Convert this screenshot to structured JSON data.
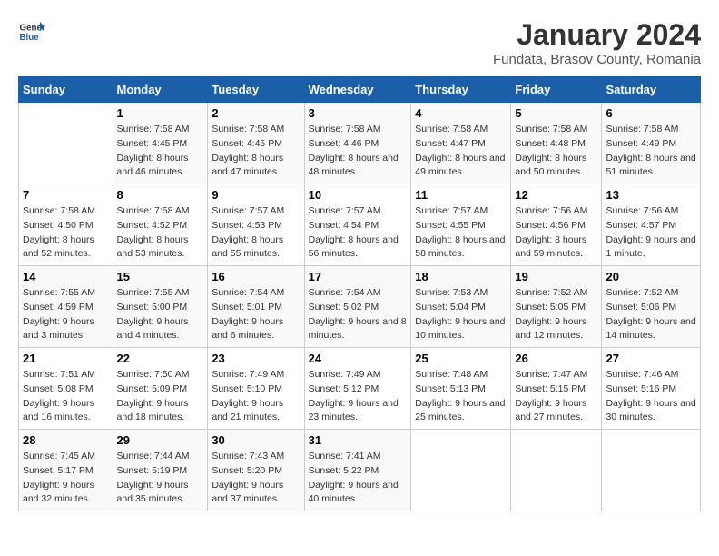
{
  "header": {
    "logo_general": "General",
    "logo_blue": "Blue",
    "title": "January 2024",
    "subtitle": "Fundata, Brasov County, Romania"
  },
  "calendar": {
    "days_of_week": [
      "Sunday",
      "Monday",
      "Tuesday",
      "Wednesday",
      "Thursday",
      "Friday",
      "Saturday"
    ],
    "weeks": [
      [
        {
          "day": "",
          "sunrise": "",
          "sunset": "",
          "daylight": ""
        },
        {
          "day": "1",
          "sunrise": "Sunrise: 7:58 AM",
          "sunset": "Sunset: 4:45 PM",
          "daylight": "Daylight: 8 hours and 46 minutes."
        },
        {
          "day": "2",
          "sunrise": "Sunrise: 7:58 AM",
          "sunset": "Sunset: 4:45 PM",
          "daylight": "Daylight: 8 hours and 47 minutes."
        },
        {
          "day": "3",
          "sunrise": "Sunrise: 7:58 AM",
          "sunset": "Sunset: 4:46 PM",
          "daylight": "Daylight: 8 hours and 48 minutes."
        },
        {
          "day": "4",
          "sunrise": "Sunrise: 7:58 AM",
          "sunset": "Sunset: 4:47 PM",
          "daylight": "Daylight: 8 hours and 49 minutes."
        },
        {
          "day": "5",
          "sunrise": "Sunrise: 7:58 AM",
          "sunset": "Sunset: 4:48 PM",
          "daylight": "Daylight: 8 hours and 50 minutes."
        },
        {
          "day": "6",
          "sunrise": "Sunrise: 7:58 AM",
          "sunset": "Sunset: 4:49 PM",
          "daylight": "Daylight: 8 hours and 51 minutes."
        }
      ],
      [
        {
          "day": "7",
          "sunrise": "Sunrise: 7:58 AM",
          "sunset": "Sunset: 4:50 PM",
          "daylight": "Daylight: 8 hours and 52 minutes."
        },
        {
          "day": "8",
          "sunrise": "Sunrise: 7:58 AM",
          "sunset": "Sunset: 4:52 PM",
          "daylight": "Daylight: 8 hours and 53 minutes."
        },
        {
          "day": "9",
          "sunrise": "Sunrise: 7:57 AM",
          "sunset": "Sunset: 4:53 PM",
          "daylight": "Daylight: 8 hours and 55 minutes."
        },
        {
          "day": "10",
          "sunrise": "Sunrise: 7:57 AM",
          "sunset": "Sunset: 4:54 PM",
          "daylight": "Daylight: 8 hours and 56 minutes."
        },
        {
          "day": "11",
          "sunrise": "Sunrise: 7:57 AM",
          "sunset": "Sunset: 4:55 PM",
          "daylight": "Daylight: 8 hours and 58 minutes."
        },
        {
          "day": "12",
          "sunrise": "Sunrise: 7:56 AM",
          "sunset": "Sunset: 4:56 PM",
          "daylight": "Daylight: 8 hours and 59 minutes."
        },
        {
          "day": "13",
          "sunrise": "Sunrise: 7:56 AM",
          "sunset": "Sunset: 4:57 PM",
          "daylight": "Daylight: 9 hours and 1 minute."
        }
      ],
      [
        {
          "day": "14",
          "sunrise": "Sunrise: 7:55 AM",
          "sunset": "Sunset: 4:59 PM",
          "daylight": "Daylight: 9 hours and 3 minutes."
        },
        {
          "day": "15",
          "sunrise": "Sunrise: 7:55 AM",
          "sunset": "Sunset: 5:00 PM",
          "daylight": "Daylight: 9 hours and 4 minutes."
        },
        {
          "day": "16",
          "sunrise": "Sunrise: 7:54 AM",
          "sunset": "Sunset: 5:01 PM",
          "daylight": "Daylight: 9 hours and 6 minutes."
        },
        {
          "day": "17",
          "sunrise": "Sunrise: 7:54 AM",
          "sunset": "Sunset: 5:02 PM",
          "daylight": "Daylight: 9 hours and 8 minutes."
        },
        {
          "day": "18",
          "sunrise": "Sunrise: 7:53 AM",
          "sunset": "Sunset: 5:04 PM",
          "daylight": "Daylight: 9 hours and 10 minutes."
        },
        {
          "day": "19",
          "sunrise": "Sunrise: 7:52 AM",
          "sunset": "Sunset: 5:05 PM",
          "daylight": "Daylight: 9 hours and 12 minutes."
        },
        {
          "day": "20",
          "sunrise": "Sunrise: 7:52 AM",
          "sunset": "Sunset: 5:06 PM",
          "daylight": "Daylight: 9 hours and 14 minutes."
        }
      ],
      [
        {
          "day": "21",
          "sunrise": "Sunrise: 7:51 AM",
          "sunset": "Sunset: 5:08 PM",
          "daylight": "Daylight: 9 hours and 16 minutes."
        },
        {
          "day": "22",
          "sunrise": "Sunrise: 7:50 AM",
          "sunset": "Sunset: 5:09 PM",
          "daylight": "Daylight: 9 hours and 18 minutes."
        },
        {
          "day": "23",
          "sunrise": "Sunrise: 7:49 AM",
          "sunset": "Sunset: 5:10 PM",
          "daylight": "Daylight: 9 hours and 21 minutes."
        },
        {
          "day": "24",
          "sunrise": "Sunrise: 7:49 AM",
          "sunset": "Sunset: 5:12 PM",
          "daylight": "Daylight: 9 hours and 23 minutes."
        },
        {
          "day": "25",
          "sunrise": "Sunrise: 7:48 AM",
          "sunset": "Sunset: 5:13 PM",
          "daylight": "Daylight: 9 hours and 25 minutes."
        },
        {
          "day": "26",
          "sunrise": "Sunrise: 7:47 AM",
          "sunset": "Sunset: 5:15 PM",
          "daylight": "Daylight: 9 hours and 27 minutes."
        },
        {
          "day": "27",
          "sunrise": "Sunrise: 7:46 AM",
          "sunset": "Sunset: 5:16 PM",
          "daylight": "Daylight: 9 hours and 30 minutes."
        }
      ],
      [
        {
          "day": "28",
          "sunrise": "Sunrise: 7:45 AM",
          "sunset": "Sunset: 5:17 PM",
          "daylight": "Daylight: 9 hours and 32 minutes."
        },
        {
          "day": "29",
          "sunrise": "Sunrise: 7:44 AM",
          "sunset": "Sunset: 5:19 PM",
          "daylight": "Daylight: 9 hours and 35 minutes."
        },
        {
          "day": "30",
          "sunrise": "Sunrise: 7:43 AM",
          "sunset": "Sunset: 5:20 PM",
          "daylight": "Daylight: 9 hours and 37 minutes."
        },
        {
          "day": "31",
          "sunrise": "Sunrise: 7:41 AM",
          "sunset": "Sunset: 5:22 PM",
          "daylight": "Daylight: 9 hours and 40 minutes."
        },
        {
          "day": "",
          "sunrise": "",
          "sunset": "",
          "daylight": ""
        },
        {
          "day": "",
          "sunrise": "",
          "sunset": "",
          "daylight": ""
        },
        {
          "day": "",
          "sunrise": "",
          "sunset": "",
          "daylight": ""
        }
      ]
    ]
  }
}
